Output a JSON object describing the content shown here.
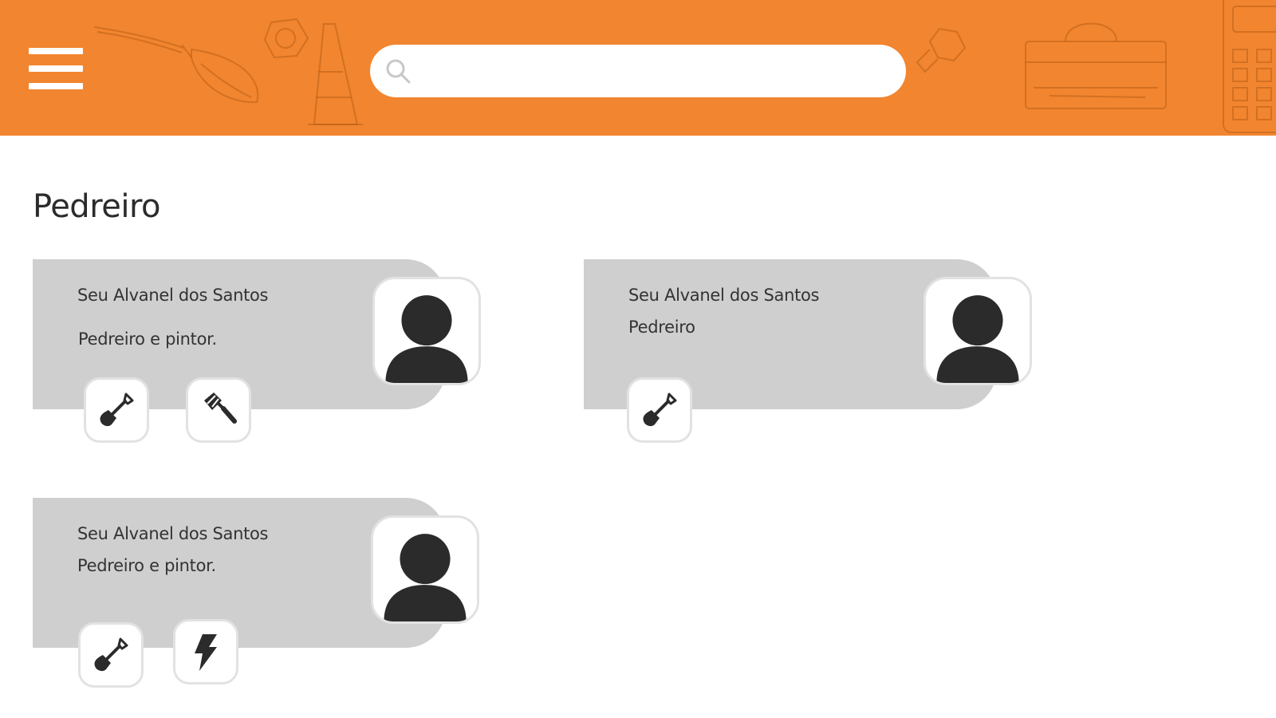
{
  "header": {
    "background_color": "#F2852F",
    "menu_icon": "hamburger-menu-icon",
    "decoration_icons": [
      "paintbrush-icon",
      "hex-nut-icon",
      "traffic-cone-icon",
      "bolt-nut-icon",
      "toolbox-icon",
      "calculator-icon"
    ]
  },
  "search": {
    "icon": "search-icon",
    "placeholder": "",
    "value": ""
  },
  "page": {
    "title": "Pedreiro"
  },
  "cards": [
    {
      "name": "Seu Alvanel dos Santos",
      "description": "Pedreiro e pintor.",
      "avatar_icon": "user-avatar-icon",
      "services": [
        "shovel-icon",
        "paint-roller-icon"
      ]
    },
    {
      "name": "Seu Alvanel dos Santos",
      "description": "Pedreiro",
      "avatar_icon": "user-avatar-icon",
      "services": [
        "shovel-icon"
      ]
    },
    {
      "name": "Seu Alvanel dos Santos",
      "description": "Pedreiro e pintor.",
      "avatar_icon": "user-avatar-icon",
      "services": [
        "shovel-icon",
        "lightning-icon"
      ]
    }
  ],
  "colors": {
    "card_background": "#CFCFCF",
    "icon_color": "#2b2b2b"
  }
}
